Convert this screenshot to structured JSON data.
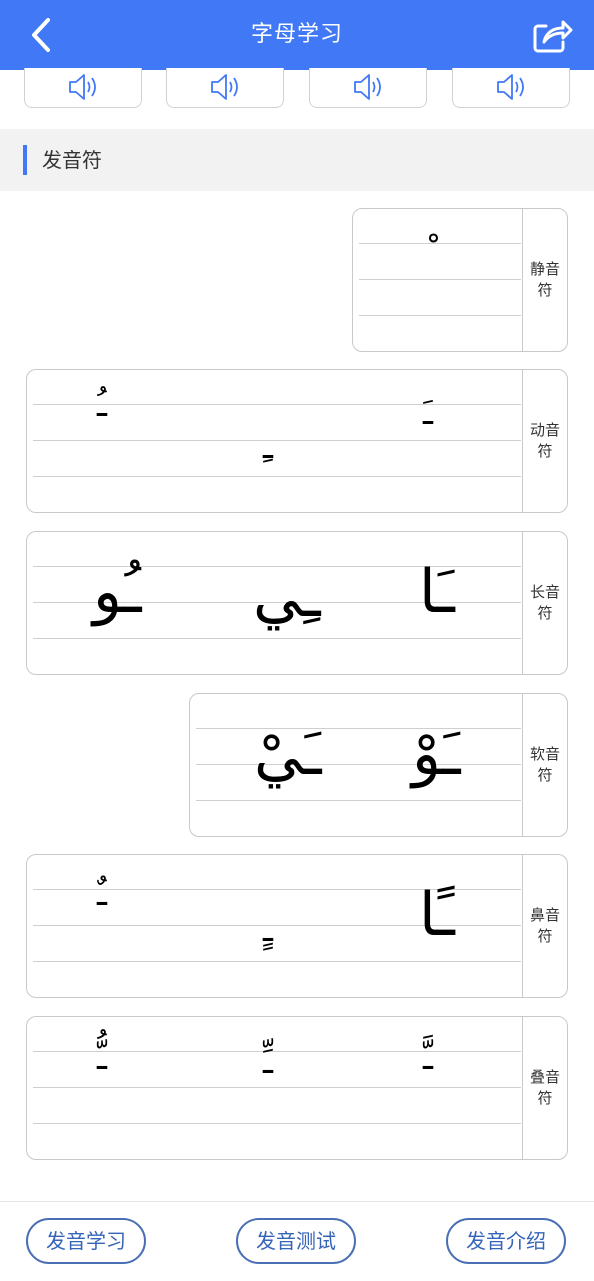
{
  "header": {
    "title": "字母学习"
  },
  "sound_buttons": [
    "speaker-icon",
    "speaker-icon",
    "speaker-icon",
    "speaker-icon"
  ],
  "section": {
    "title": "发音符"
  },
  "cards": [
    {
      "label": "静音符",
      "glyphs": [
        "ْ"
      ]
    },
    {
      "label": "动音符",
      "glyphs": [
        "ـَ",
        "ـِ",
        "ـُ"
      ]
    },
    {
      "label": "长音符",
      "glyphs": [
        "ـَا",
        "ـِي",
        "ـُو"
      ]
    },
    {
      "label": "软音符",
      "glyphs": [
        "ـَوْ",
        "ـَيْ"
      ]
    },
    {
      "label": "鼻音符",
      "glyphs": [
        "ـًا",
        "ـٍ",
        "ـٌ"
      ]
    },
    {
      "label": "叠音符",
      "glyphs": [
        "ـَّ",
        "ـِّ",
        "ـُّ"
      ]
    }
  ],
  "bottom_buttons": [
    "发音学习",
    "发音测试",
    "发音介绍"
  ],
  "colors": {
    "primary": "#4078f5",
    "button_text": "#3564b8"
  }
}
